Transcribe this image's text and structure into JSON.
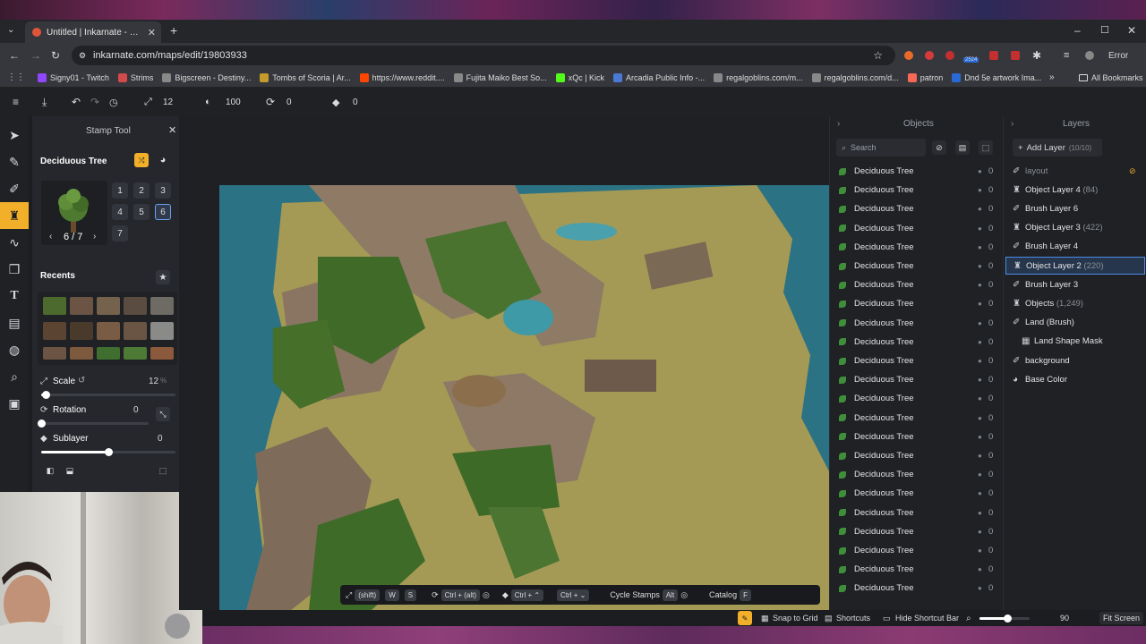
{
  "browser": {
    "tab_title": "Untitled | Inkarnate - Create Fa",
    "url": "inkarnate.com/maps/edit/19803933",
    "error_label": "Error",
    "all_bookmarks": "All Bookmarks",
    "bookmarks": [
      "Signy01 - Twitch",
      "Strims",
      "Bigscreen - Destiny...",
      "Tombs of Scoria | Ar...",
      "https://www.reddit....",
      "Fujita Maiko Best So...",
      "xQc | Kick",
      "Arcadia Public Info -...",
      "regalgoblins.com/m...",
      "regalgoblins.com/d...",
      "patron",
      "Dnd 5e artwork Ima..."
    ],
    "badge_count": "2524"
  },
  "toolbar": {
    "brush_size": "12",
    "opacity": "100",
    "rotation": "0",
    "layer_offset": "0"
  },
  "stamp_panel": {
    "title": "Stamp Tool",
    "stamp_name": "Deciduous Tree",
    "variation_label": "6 / 7",
    "variants": [
      "1",
      "2",
      "3",
      "4",
      "5",
      "6",
      "7"
    ],
    "selected_variant": "6",
    "recents_label": "Recents",
    "scale_label": "Scale",
    "scale_value": "12",
    "scale_unit": "%",
    "scale_fraction": 0.03,
    "rotation_label": "Rotation",
    "rotation_value": "0",
    "rotation_fraction": 0.0,
    "sublayer_label": "Sublayer",
    "sublayer_value": "0",
    "sublayer_fraction": 0.5
  },
  "canvas_bar": {
    "shift": "(shift)",
    "w": "W",
    "s": "S",
    "ctrl_alt": "Ctrl + (alt)",
    "ctrl_a": "Ctrl + ⌃",
    "ctrl_b": "Ctrl + ⌄",
    "cycle_stamps": "Cycle Stamps",
    "alt": "Alt",
    "catalog": "Catalog",
    "f": "F"
  },
  "objects": {
    "header": "Objects",
    "search_placeholder": "Search",
    "items": [
      {
        "name": "Deciduous Tree",
        "count": "0"
      },
      {
        "name": "Deciduous Tree",
        "count": "0"
      },
      {
        "name": "Deciduous Tree",
        "count": "0"
      },
      {
        "name": "Deciduous Tree",
        "count": "0"
      },
      {
        "name": "Deciduous Tree",
        "count": "0"
      },
      {
        "name": "Deciduous Tree",
        "count": "0"
      },
      {
        "name": "Deciduous Tree",
        "count": "0"
      },
      {
        "name": "Deciduous Tree",
        "count": "0"
      },
      {
        "name": "Deciduous Tree",
        "count": "0"
      },
      {
        "name": "Deciduous Tree",
        "count": "0"
      },
      {
        "name": "Deciduous Tree",
        "count": "0"
      },
      {
        "name": "Deciduous Tree",
        "count": "0"
      },
      {
        "name": "Deciduous Tree",
        "count": "0"
      },
      {
        "name": "Deciduous Tree",
        "count": "0"
      },
      {
        "name": "Deciduous Tree",
        "count": "0"
      },
      {
        "name": "Deciduous Tree",
        "count": "0"
      },
      {
        "name": "Deciduous Tree",
        "count": "0"
      },
      {
        "name": "Deciduous Tree",
        "count": "0"
      },
      {
        "name": "Deciduous Tree",
        "count": "0"
      },
      {
        "name": "Deciduous Tree",
        "count": "0"
      },
      {
        "name": "Deciduous Tree",
        "count": "0"
      },
      {
        "name": "Deciduous Tree",
        "count": "0"
      },
      {
        "name": "Deciduous Tree",
        "count": "0"
      }
    ]
  },
  "layers": {
    "header": "Layers",
    "add_layer": "Add Layer",
    "add_layer_count": "(10/10)",
    "items": [
      {
        "name": "layout",
        "count": "",
        "icon": "brush-icon",
        "dim": true
      },
      {
        "name": "Object Layer 4",
        "count": "(84)",
        "icon": "stamp-icon"
      },
      {
        "name": "Brush Layer 6",
        "count": "",
        "icon": "brush-icon"
      },
      {
        "name": "Object Layer 3",
        "count": "(422)",
        "icon": "stamp-icon"
      },
      {
        "name": "Brush Layer 4",
        "count": "",
        "icon": "brush-icon"
      },
      {
        "name": "Object Layer 2",
        "count": "(220)",
        "icon": "stamp-icon",
        "selected": true
      },
      {
        "name": "Brush Layer 3",
        "count": "",
        "icon": "brush-icon"
      },
      {
        "name": "Objects",
        "count": "(1,249)",
        "icon": "stamp-icon"
      },
      {
        "name": "Land (Brush)",
        "count": "",
        "icon": "brush-icon"
      },
      {
        "name": "Land Shape Mask",
        "count": "",
        "icon": "mask-icon",
        "indent": true
      },
      {
        "name": "background",
        "count": "",
        "icon": "brush-icon"
      },
      {
        "name": "Base Color",
        "count": "",
        "icon": "palette-icon"
      }
    ]
  },
  "statusbar": {
    "snap": "Snap to Grid",
    "shortcuts": "Shortcuts",
    "hide_shortcut": "Hide Shortcut Bar",
    "zoom": "90",
    "zoom_fraction": 0.55,
    "fit": "Fit Screen"
  }
}
